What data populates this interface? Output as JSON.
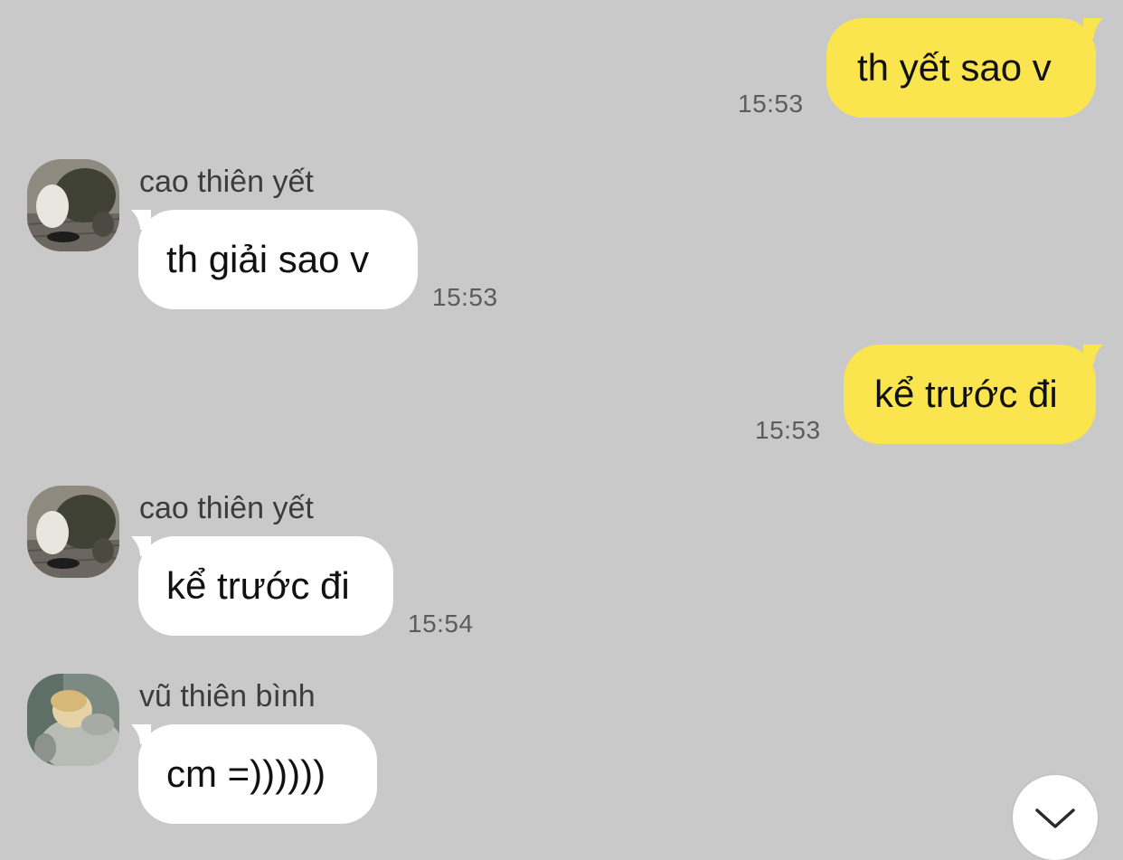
{
  "messages": [
    {
      "direction": "out",
      "text": "th yết sao v",
      "time": "15:53"
    },
    {
      "direction": "in",
      "sender": "cao thiên yết",
      "text": "th giải sao v",
      "time": "15:53",
      "avatar": "avatar-photo-person-crouching"
    },
    {
      "direction": "out",
      "text": "kể trước đi",
      "time": "15:53"
    },
    {
      "direction": "in",
      "sender": "cao thiên yết",
      "text": "kể trước đi",
      "time": "15:54",
      "avatar": "avatar-photo-person-crouching"
    },
    {
      "direction": "in",
      "sender": "vũ thiên bình",
      "text": "cm =))))))",
      "avatar": "avatar-photo-sleeping-baby"
    }
  ],
  "scroll_down_button": {
    "icon": "chevron-down-icon"
  },
  "colors": {
    "background": "#c9c9c9",
    "outgoing_bubble": "#fae54e",
    "incoming_bubble": "#ffffff",
    "timestamp": "#5c5c5c",
    "sender_name": "#3c3c3c"
  }
}
